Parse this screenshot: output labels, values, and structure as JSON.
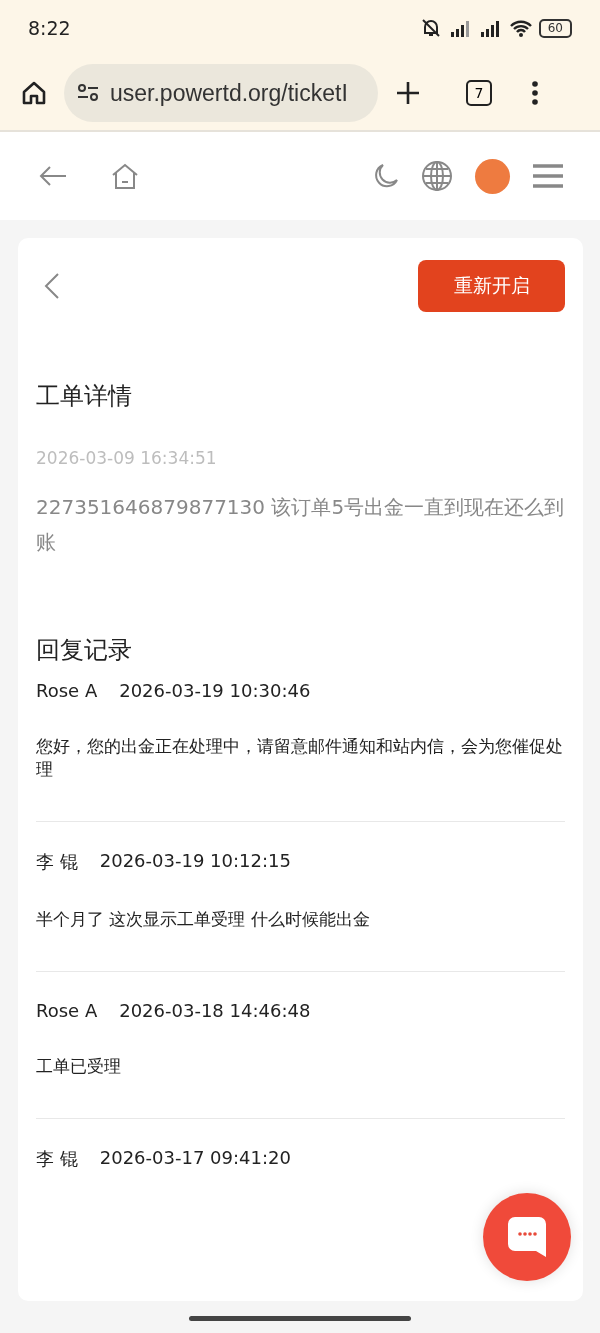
{
  "status_bar": {
    "time": "8:22",
    "battery": "60"
  },
  "browser": {
    "url": "user.powertd.org/ticketI",
    "tab_count": "7"
  },
  "ticket": {
    "reopen_button": "重新开启",
    "title": "工单详情",
    "date": "2026-03-09 16:34:51",
    "content": "227351646879877130 该订单5号出金一直到现在还么到账"
  },
  "replies_title": "回复记录",
  "replies": [
    {
      "author": "Rose A",
      "time": "2026-03-19 10:30:46",
      "message": "您好，您的出金正在处理中，请留意邮件通知和站内信，会为您催促处理"
    },
    {
      "author": "李 锟",
      "time": "2026-03-19 10:12:15",
      "message": "半个月了 这次显示工单受理 什么时候能出金"
    },
    {
      "author": "Rose A",
      "time": "2026-03-18 14:46:48",
      "message": "工单已受理"
    },
    {
      "author": "李 锟",
      "time": "2026-03-17 09:41:20"
    }
  ]
}
